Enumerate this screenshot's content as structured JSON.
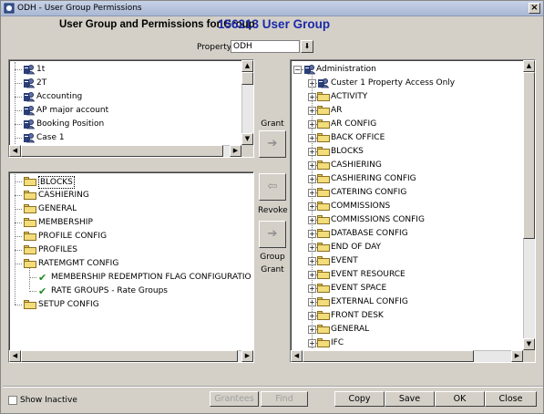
{
  "window": {
    "title": "ODH - User Group Permissions",
    "close": "×"
  },
  "header": {
    "label": "User Group and Permissions for Group",
    "group": "156213 User Group"
  },
  "property": {
    "label": "Property",
    "value": "ODH",
    "drop": "⬇"
  },
  "groups": {
    "items": [
      "1t",
      "2T",
      "Accounting",
      "AP  major account",
      "Booking Position",
      "Case 1"
    ]
  },
  "granted": {
    "items": [
      {
        "label": "BLOCKS",
        "level": 0,
        "type": "folder",
        "selected": true
      },
      {
        "label": "CASHIERING",
        "level": 0,
        "type": "folder"
      },
      {
        "label": "GENERAL",
        "level": 0,
        "type": "folder"
      },
      {
        "label": "MEMBERSHIP",
        "level": 0,
        "type": "folder"
      },
      {
        "label": "PROFILE CONFIG",
        "level": 0,
        "type": "folder"
      },
      {
        "label": "PROFILES",
        "level": 0,
        "type": "folder"
      },
      {
        "label": "RATEMGMT CONFIG",
        "level": 0,
        "type": "folder",
        "expanded": true
      },
      {
        "label": "MEMBERSHIP REDEMPTION FLAG CONFIGURATION -",
        "level": 1,
        "type": "check"
      },
      {
        "label": "RATE GROUPS - Rate Groups",
        "level": 1,
        "type": "check"
      },
      {
        "label": "SETUP CONFIG",
        "level": 0,
        "type": "folder"
      }
    ]
  },
  "available": {
    "root": "Administration",
    "items": [
      {
        "label": "Custer 1 Property Access Only",
        "type": "user"
      },
      {
        "label": "ACTIVITY",
        "type": "folder"
      },
      {
        "label": "AR",
        "type": "folder"
      },
      {
        "label": "AR CONFIG",
        "type": "folder"
      },
      {
        "label": "BACK OFFICE",
        "type": "folder"
      },
      {
        "label": "BLOCKS",
        "type": "folder"
      },
      {
        "label": "CASHIERING",
        "type": "folder"
      },
      {
        "label": "CASHIERING CONFIG",
        "type": "folder"
      },
      {
        "label": "CATERING CONFIG",
        "type": "folder"
      },
      {
        "label": "COMMISSIONS",
        "type": "folder"
      },
      {
        "label": "COMMISSIONS CONFIG",
        "type": "folder"
      },
      {
        "label": "DATABASE CONFIG",
        "type": "folder"
      },
      {
        "label": "END OF DAY",
        "type": "folder"
      },
      {
        "label": "EVENT",
        "type": "folder"
      },
      {
        "label": "EVENT RESOURCE",
        "type": "folder"
      },
      {
        "label": "EVENT SPACE",
        "type": "folder"
      },
      {
        "label": "EXTERNAL CONFIG",
        "type": "folder"
      },
      {
        "label": "FRONT DESK",
        "type": "folder"
      },
      {
        "label": "GENERAL",
        "type": "folder"
      },
      {
        "label": "IFC",
        "type": "folder"
      }
    ]
  },
  "middle": {
    "grant": "Grant",
    "revoke": "Revoke",
    "group_grant_1": "Group",
    "group_grant_2": "Grant",
    "arrow_right": "➔",
    "arrow_left": "⇦"
  },
  "footer": {
    "show_inactive": "Show Inactive",
    "grantees": "Grantees",
    "find": "Find",
    "copy": "Copy",
    "save": "Save",
    "ok": "OK",
    "close": "Close"
  },
  "colors": {
    "heading_group": "#1b2aa8",
    "check": "#1e8a1e",
    "folder": "#f3dc7a"
  }
}
